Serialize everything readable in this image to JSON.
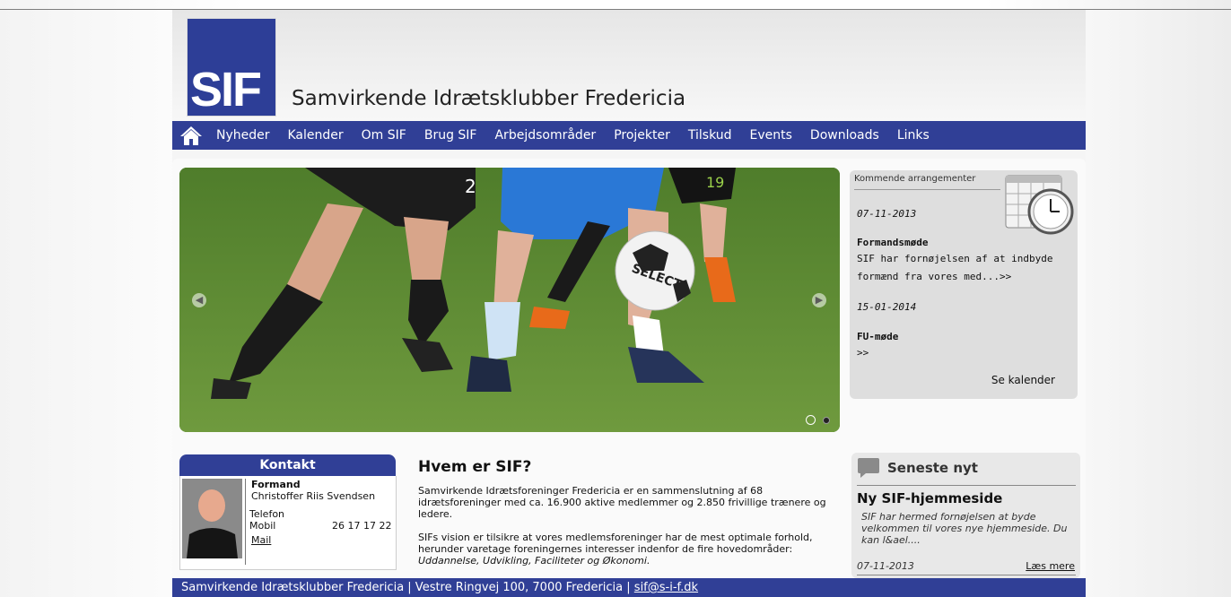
{
  "site": {
    "logo_text": "SIF",
    "title": "Samvirkende Idrætsklubber Fredericia"
  },
  "nav": {
    "items": [
      "Nyheder",
      "Kalender",
      "Om SIF",
      "Brug SIF",
      "Arbejdsområder",
      "Projekter",
      "Tilskud",
      "Events",
      "Downloads",
      "Links"
    ]
  },
  "slider": {
    "left_arrow": "◀",
    "right_arrow": "▶",
    "ball_text": "SELECT",
    "shirt_numbers": [
      "2",
      "19"
    ]
  },
  "events": {
    "header": "Kommende arrangementer",
    "items": [
      {
        "date": "07-11-2013",
        "title": "Formandsmøde",
        "text_line1": "SIF har fornøjelsen af at indbyde",
        "text_line2": "formænd fra vores med...>>"
      },
      {
        "date": "15-01-2014",
        "title": "FU-møde",
        "text_line1": ">>"
      }
    ],
    "see_calendar": "Se kalender"
  },
  "contact": {
    "header": "Kontakt",
    "role": "Formand",
    "name": "Christoffer Riis Svendsen",
    "phone_label": "Telefon",
    "mobile_label": "Mobil",
    "mobile": "26 17 17 22",
    "mail": "Mail"
  },
  "about": {
    "title": "Hvem er SIF?",
    "p1": "Samvirkende Idrætsforeninger Fredericia er en sammenslutning af 68 idrætsforeninger med ca. 16.900 aktive medlemmer og 2.850 frivillige trænere og ledere.",
    "p2": "SIFs vision er tilsikre at vores medlemsforeninger har de mest optimale forhold, herunder varetage foreningernes interesser indenfor de fire hovedområder:",
    "p2_italic": "Uddannelse, Udvikling, Faciliteter og Økonomi."
  },
  "news": {
    "header": "Seneste nyt",
    "title": "Ny SIF-hjemmeside",
    "text": "SIF har hermed fornøjelsen at byde velkommen til vores nye hjemmeside. Du kan l&ael....",
    "date": "07-11-2013",
    "more": "Læs mere"
  },
  "footer": {
    "text": "Samvirkende Idrætsklubber Fredericia | Vestre Ringvej 100, 7000 Fredericia |",
    "email": "sif@s-i-f.dk"
  },
  "colors": {
    "brand_blue": "#303f96",
    "logo_blue": "#2d3e97"
  }
}
